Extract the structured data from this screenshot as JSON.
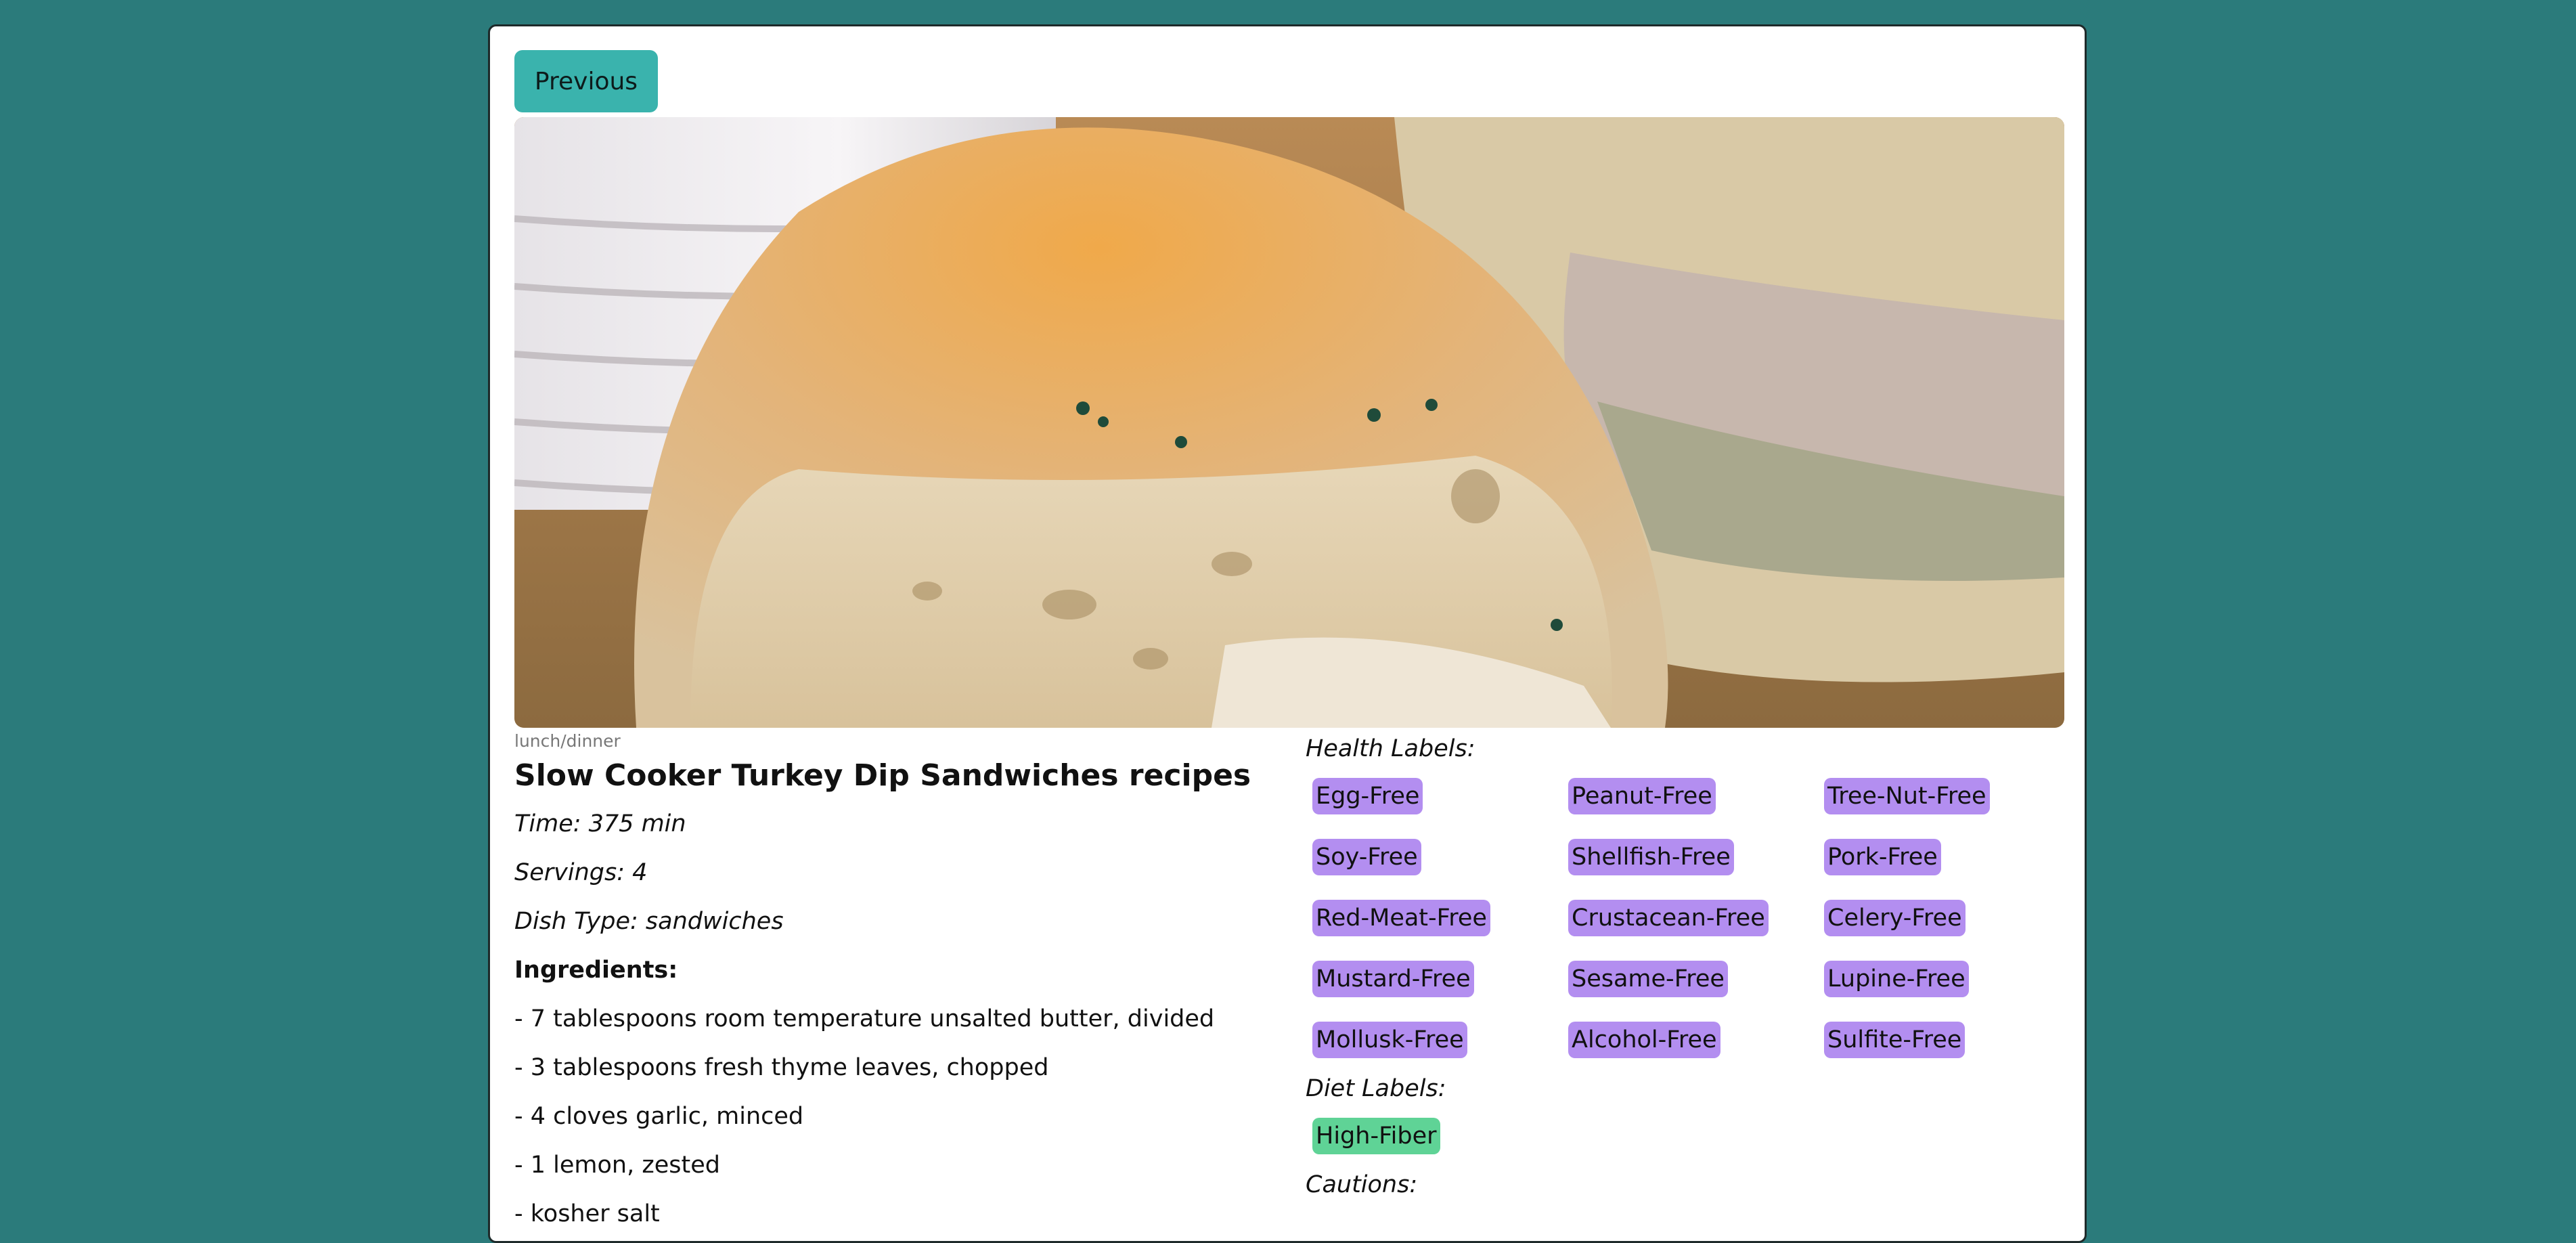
{
  "nav": {
    "previous_label": "Previous"
  },
  "hero": {
    "image_name": "sandwich-photo"
  },
  "recipe": {
    "meal_type": "lunch/dinner",
    "title": "Slow Cooker Turkey Dip Sandwiches recipes",
    "time": "Time: 375 min",
    "servings": "Servings: 4",
    "dish_type": "Dish Type: sandwiches",
    "ingredients_heading": "Ingredients:",
    "ingredients": [
      "- 7 tablespoons room temperature unsalted butter, divided",
      "- 3 tablespoons fresh thyme leaves, chopped",
      "- 4 cloves garlic, minced",
      "- 1 lemon, zested",
      "- kosher salt"
    ]
  },
  "labels": {
    "health_heading": "Health Labels:",
    "health": [
      "Egg-Free",
      "Peanut-Free",
      "Tree-Nut-Free",
      "Soy-Free",
      "Shellfish-Free",
      "Pork-Free",
      "Red-Meat-Free",
      "Crustacean-Free",
      "Celery-Free",
      "Mustard-Free",
      "Sesame-Free",
      "Lupine-Free",
      "Mollusk-Free",
      "Alcohol-Free",
      "Sulfite-Free"
    ],
    "diet_heading": "Diet Labels:",
    "diet": [
      "High-Fiber"
    ],
    "cautions_heading": "Cautions:"
  },
  "colors": {
    "background": "#2b7b7b",
    "button": "#3ab3ad",
    "health_tag": "#b38ef0",
    "diet_tag": "#5fd396"
  }
}
